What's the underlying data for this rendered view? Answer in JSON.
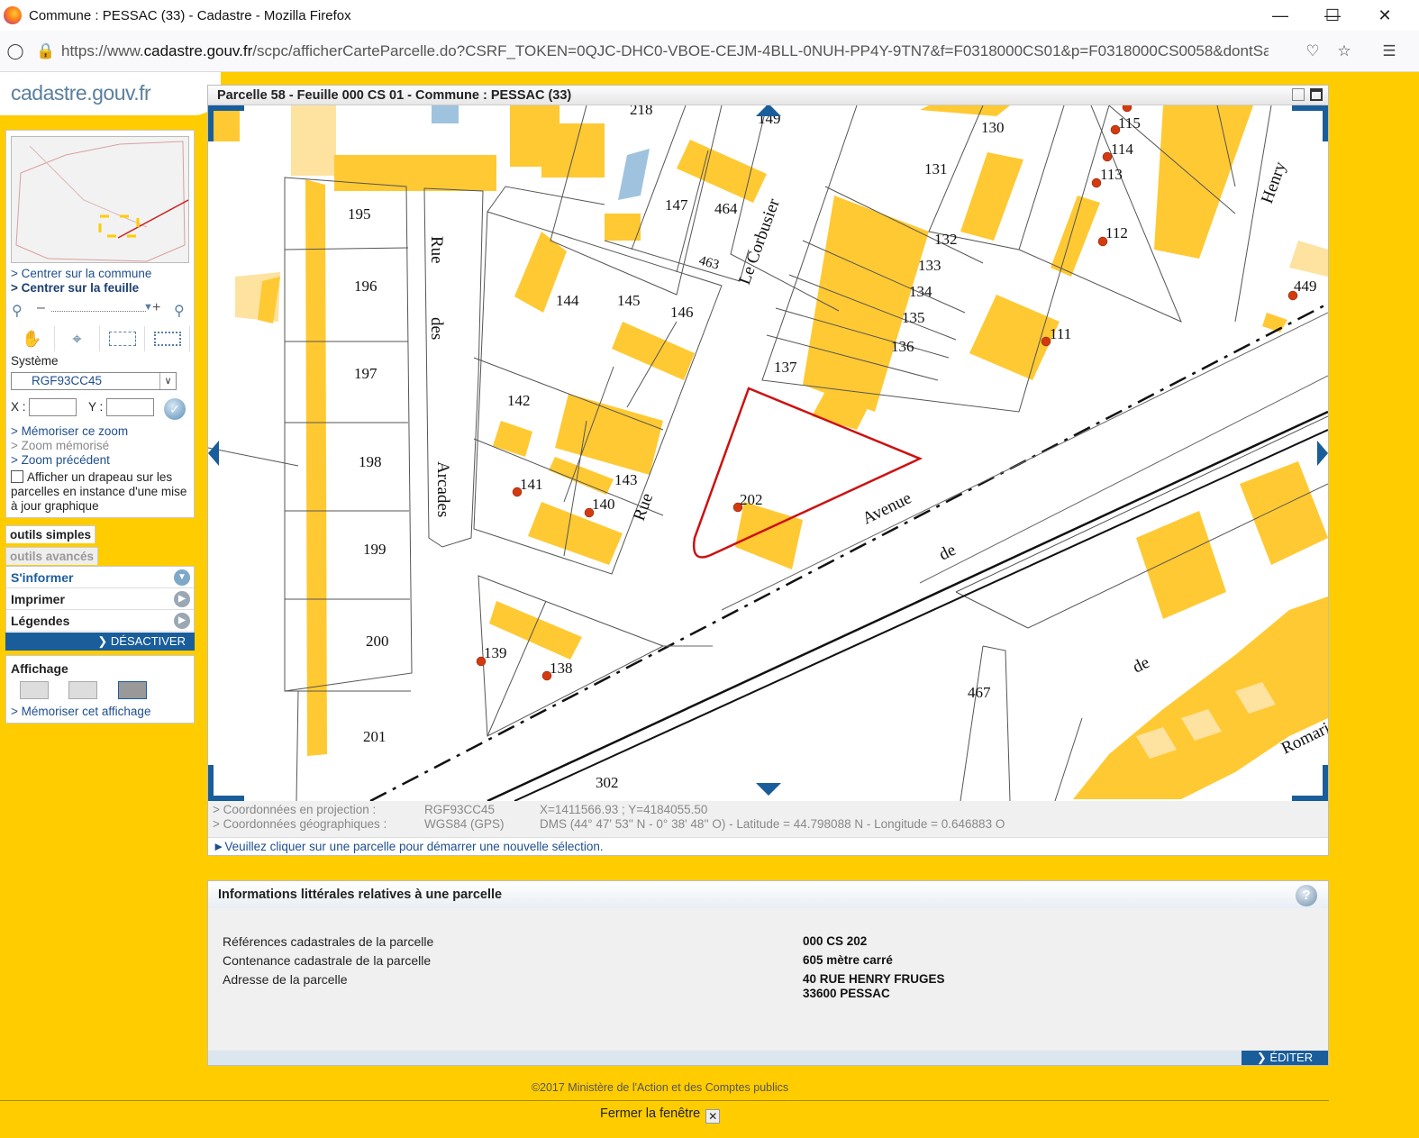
{
  "browser": {
    "window_title": "Commune : PESSAC (33) - Cadastre - Mozilla Firefox",
    "url_prefix": "https://www.",
    "url_domain": "cadastre.gouv.fr",
    "url_rest": "/scpc/afficherCarteParcelle.do?CSRF_TOKEN=0QJC-DHC0-VBOE-CEJM-4BLL-0NUH-PP4Y-9TN7&f=F0318000CS01&p=F0318000CS0058&dontSaveL"
  },
  "site": {
    "logo": "cadastre.gouv.fr"
  },
  "left": {
    "links": {
      "centrer_commune": "> Centrer sur la commune",
      "centrer_feuille": "> Centrer sur la feuille",
      "memoriser_zoom": "> Mémoriser ce zoom",
      "zoom_memorise": "> Zoom mémorisé",
      "zoom_precedent": "> Zoom précédent"
    },
    "systeme_label": "Système",
    "systeme_value": "RGF93CC45",
    "x_label": "X :",
    "y_label": "Y :",
    "flag_label": "Afficher un drapeau sur les parcelles en instance d'une mise à jour graphique"
  },
  "tabs": {
    "simple": "outils simples",
    "avance": "outils avancés"
  },
  "menu": {
    "informer": "S'informer",
    "imprimer": "Imprimer",
    "legendes": "Légendes",
    "desactiver": "DÉSACTIVER"
  },
  "affichage": {
    "title": "Affichage",
    "memoriser": "> Mémoriser cet affichage"
  },
  "map": {
    "title": "Parcelle 58 - Feuille 000 CS 01 - Commune : PESSAC (33)",
    "parcels": [
      "218",
      "149",
      "130",
      "115",
      "114",
      "113",
      "131",
      "147",
      "464",
      "463",
      "195",
      "196",
      "197",
      "198",
      "199",
      "200",
      "201",
      "144",
      "145",
      "146",
      "142",
      "141",
      "140",
      "143",
      "139",
      "138",
      "132",
      "133",
      "134",
      "135",
      "136",
      "137",
      "112",
      "111",
      "449",
      "202",
      "467",
      "302"
    ],
    "streets": {
      "rue": "Rue",
      "des": "des",
      "arcades": "Arcades",
      "rue2": "Rue",
      "corbusier": "Le Corbusier",
      "henry": "Henry",
      "avenue": "Avenue",
      "de1": "de",
      "de2": "de",
      "romain": "Romari"
    }
  },
  "coords": {
    "proj_label": "> Coordonnées en projection :",
    "proj_sys": "RGF93CC45",
    "proj_val": "X=1411566.93 ; Y=4184055.50",
    "geo_label": "> Coordonnées géographiques :",
    "geo_sys": "WGS84 (GPS)",
    "geo_val": "DMS (44° 47' 53'' N - 0° 38' 48'' O) - Latitude = 44.798088 N - Longitude = 0.646883 O",
    "message": "Veuillez cliquer sur une parcelle pour démarrer une nouvelle sélection."
  },
  "info": {
    "title": "Informations littérales relatives à une parcelle",
    "rows": [
      {
        "label": "Références cadastrales de la parcelle",
        "value": "000 CS 202"
      },
      {
        "label": "Contenance cadastrale de la parcelle",
        "value": "605 mètre carré"
      },
      {
        "label": "Adresse de la parcelle",
        "value": "40 RUE HENRY FRUGES",
        "value2": "33600 PESSAC"
      }
    ],
    "editer": "ÉDITER"
  },
  "footer": {
    "copyright": "©2017 Ministère de l'Action et des Comptes publics",
    "close": "Fermer la fenêtre"
  },
  "colors": {
    "building": "#ffc933",
    "page_bg": "#ffcc00",
    "selected_parcel": "#cc1111",
    "frame_blue": "#1a5d9b"
  }
}
